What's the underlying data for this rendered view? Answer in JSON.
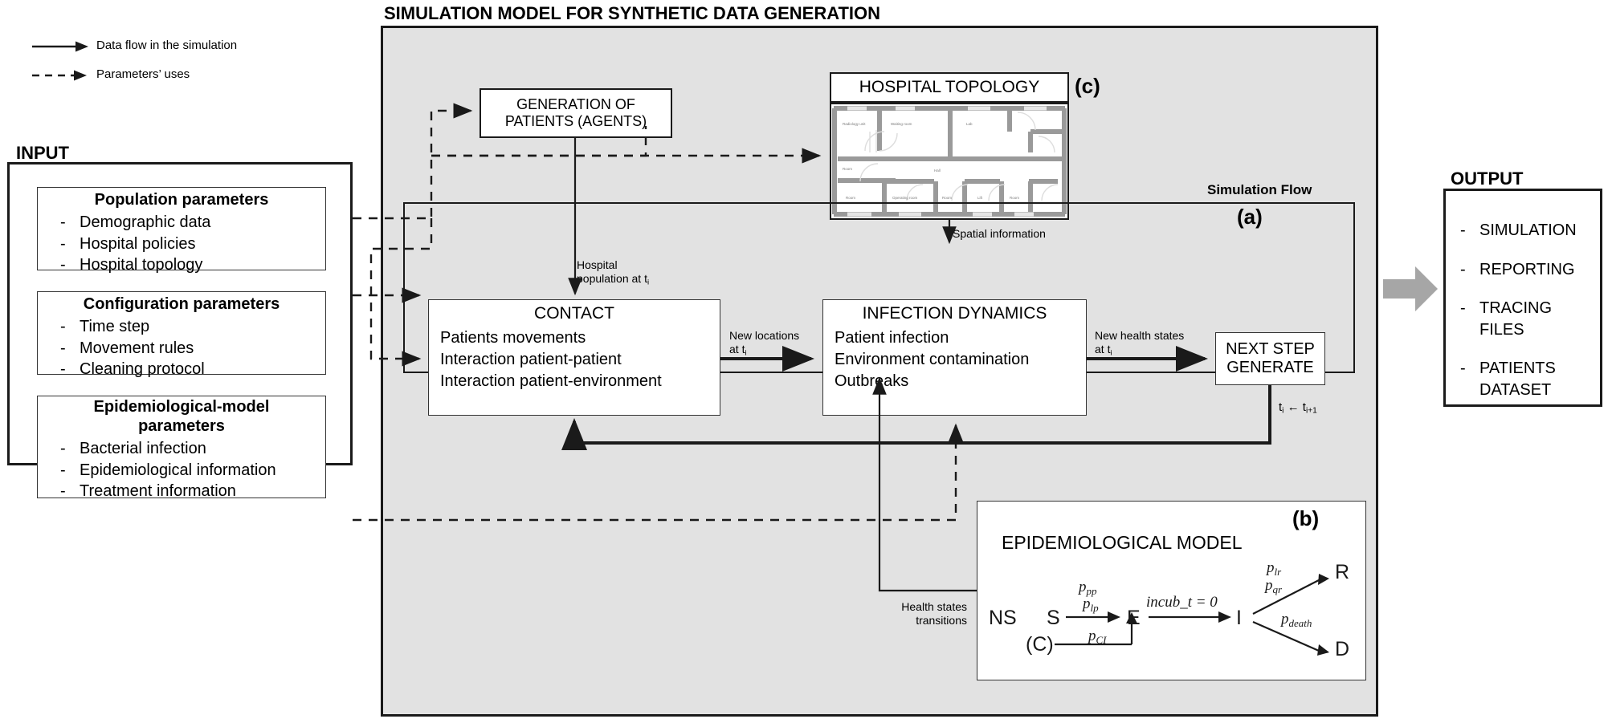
{
  "legend": {
    "items": [
      {
        "label": "Data flow in the simulation",
        "style": "solid-arrow"
      },
      {
        "label": "Parameters’ uses",
        "style": "dashed-arrow"
      }
    ]
  },
  "input": {
    "title": "INPUT",
    "groups": [
      {
        "title": "Population parameters",
        "items": [
          "Demographic data",
          "Hospital policies",
          "Hospital topology"
        ]
      },
      {
        "title": "Configuration parameters",
        "items": [
          "Time step",
          "Movement rules",
          "Cleaning protocol"
        ]
      },
      {
        "title": "Epidemiological-model parameters",
        "items": [
          "Bacterial infection",
          "Epidemiological information",
          "Treatment information"
        ]
      }
    ]
  },
  "simulation": {
    "title": "SIMULATION MODEL FOR SYNTHETIC DATA GENERATION",
    "generation_box": {
      "line1": "GENERATION OF",
      "line2": "PATIENTS (AGENTS)"
    },
    "hospital_topology": {
      "title": "HOSPITAL TOPOLOGY",
      "tag": "(c)"
    },
    "flow": {
      "title": "Simulation Flow",
      "tag": "(a)",
      "contact": {
        "title": "CONTACT",
        "items": [
          "Patients movements",
          "Interaction patient-patient",
          "Interaction patient-environment"
        ]
      },
      "infection": {
        "title": "INFECTION DYNAMICS",
        "items": [
          "Patient infection",
          "Environment contamination",
          "Outbreaks"
        ]
      },
      "next_step": {
        "line1": "NEXT STEP",
        "line2": "GENERATE"
      }
    },
    "edge_labels": {
      "spatial_information": "Spatial information",
      "hospital_population": [
        "Hospital",
        "population at t",
        "i"
      ],
      "new_locations": [
        "New locations",
        "at t",
        "i"
      ],
      "new_health_states": [
        "New health states",
        "at t",
        "i"
      ],
      "time_increment": [
        "t",
        "i",
        " ← t",
        "i+1"
      ],
      "health_states_transitions": [
        "Health states",
        "transitions"
      ]
    },
    "epi_model": {
      "title": "EPIDEMIOLOGICAL MODEL",
      "tag": "(b)",
      "states": {
        "ns": "NS",
        "s": "S",
        "c": "(C)",
        "e": "E",
        "i": "I",
        "r": "R",
        "d": "D"
      },
      "transitions": {
        "s_to_e_top": "p",
        "s_to_e_top_sub": "pp",
        "s_to_e_bottom": "p",
        "s_to_e_bottom_sub": "lp",
        "c_to_e": "p",
        "c_to_e_sub": "CI",
        "e_to_i": "incub_t = 0",
        "i_to_r_1": "p",
        "i_to_r_1_sub": "lr",
        "i_to_r_2": "p",
        "i_to_r_2_sub": "qr",
        "i_to_d": "p",
        "i_to_d_sub": "death"
      }
    }
  },
  "output": {
    "title": "OUTPUT",
    "items": [
      "SIMULATION",
      "REPORTING",
      "TRACING FILES",
      "PATIENTS DATASET"
    ]
  },
  "colors": {
    "panel_grey": "#e2e2e2",
    "line_black": "#1a1a1a",
    "arrow_grey": "#a6a6a6",
    "wall_grey": "#9a9a9a"
  }
}
